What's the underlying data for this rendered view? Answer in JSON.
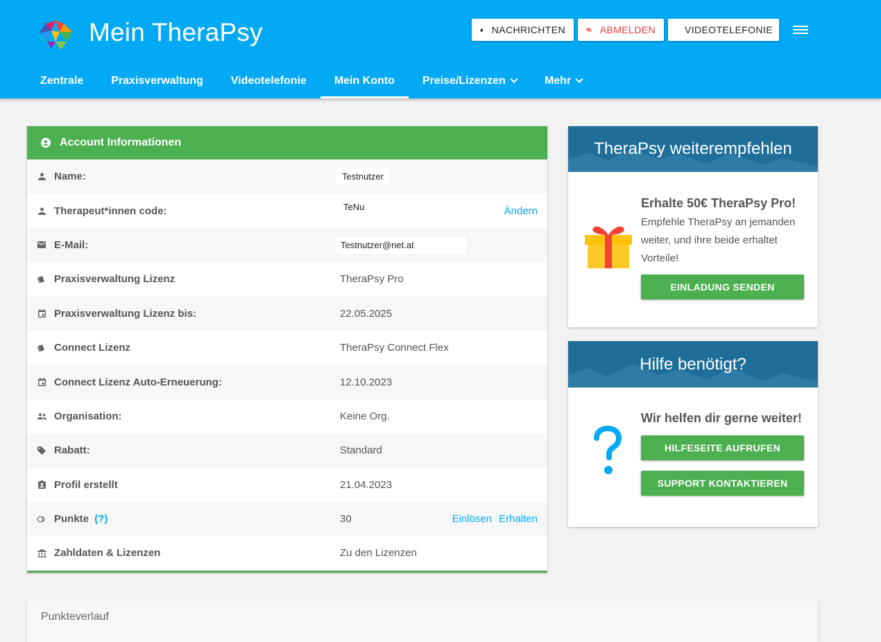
{
  "header": {
    "title": "Mein TheraPsy",
    "buttons": {
      "nachrichten": "NACHRICHTEN",
      "abmelden": "ABMELDEN",
      "videotelefonie": "VIDEOTELEFONIE"
    }
  },
  "nav": [
    "Zentrale",
    "Praxisverwaltung",
    "Videotelefonie",
    "Mein Konto",
    "Preise/Lizenzen",
    "Mehr"
  ],
  "account": {
    "heading": "Account Informationen",
    "rows": {
      "name": {
        "label": "Name:",
        "value": "Testnutzer"
      },
      "code": {
        "label": "Therapeut*innen code:",
        "value": "TeNu",
        "action": "Ändern"
      },
      "email": {
        "label": "E-Mail:",
        "value": "Testnutzer@net.at"
      },
      "pv_lizenz": {
        "label": "Praxisverwaltung Lizenz",
        "value": "TheraPsy Pro"
      },
      "pv_bis": {
        "label": "Praxisverwaltung Lizenz bis:",
        "value": "22.05.2025"
      },
      "connect": {
        "label": "Connect Lizenz",
        "value": "TheraPsy Connect Flex"
      },
      "connect_auto": {
        "label": "Connect Lizenz Auto-Erneuerung:",
        "value": "12.10.2023"
      },
      "org": {
        "label": "Organisation:",
        "value": "Keine Org."
      },
      "rabatt": {
        "label": "Rabatt:",
        "value": "Standard"
      },
      "profil": {
        "label": "Profil erstellt",
        "value": "21.04.2023"
      },
      "punkte": {
        "label": "Punkte",
        "help": "(?)",
        "value": "30",
        "action1": "Einlösen",
        "action2": "Erhalten"
      },
      "zahl": {
        "label": "Zahldaten & Lizenzen",
        "value": "Zu den Lizenzen"
      }
    }
  },
  "recommend": {
    "heading": "TheraPsy weiterempfehlen",
    "title": "Erhalte 50€ TheraPsy Pro!",
    "text": "Empfehle TheraPsy an jemanden weiter, und ihre beide erhaltet Vorteile!",
    "button": "EINLADUNG SENDEN"
  },
  "help": {
    "heading": "Hilfe benötigt?",
    "title": "Wir helfen dir gerne weiter!",
    "button1": "HILFESEITE AUFRUFEN",
    "button2": "SUPPORT KONTAKTIEREN"
  },
  "points_history": {
    "title": "Punkteverlauf"
  },
  "colors": {
    "primary": "#03a9f4",
    "success": "#4caf50",
    "danger": "#e53935",
    "banner": "#1f6e99"
  },
  "icons": [
    "logo-brain-icon",
    "bell-icon",
    "eye-off-icon",
    "phone-icon",
    "menu-icon",
    "account-circle-icon",
    "person-icon",
    "email-icon",
    "license-icon",
    "calendar-icon",
    "group-icon",
    "tag-icon",
    "badge-icon",
    "coins-icon",
    "bank-icon",
    "gift-icon",
    "question-icon"
  ]
}
